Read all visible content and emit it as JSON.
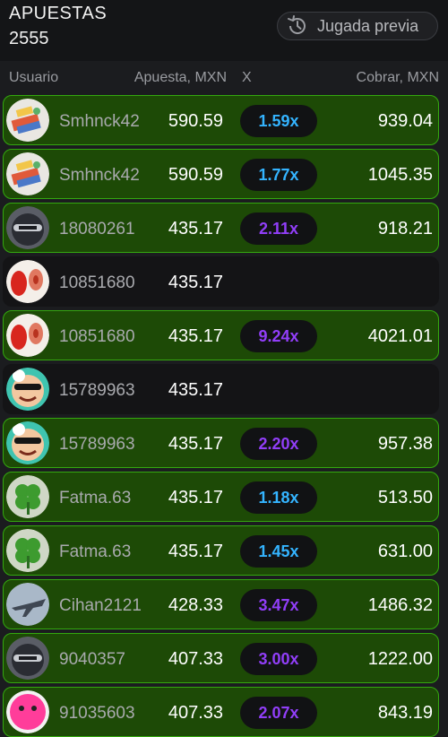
{
  "header": {
    "title": "APUESTAS",
    "count": "2555",
    "prev_button": "Jugada previa",
    "history_icon": "history-clock-icon"
  },
  "columns": {
    "user": "Usuario",
    "bet": "Apuesta, MXN",
    "mult": "X",
    "win": "Cobrar, MXN"
  },
  "colors": {
    "win_row_bg": "#1d4a06",
    "win_row_border": "#34a80f",
    "mult_blue": "#34b4ff",
    "mult_purple": "#913ef8"
  },
  "rows": [
    {
      "user": "Smhnck42",
      "bet": "590.59",
      "mult": "1.59x",
      "win": "939.04",
      "won": true,
      "mult_color": "#34b4ff",
      "avatar": "colorful-pattern-avatar"
    },
    {
      "user": "Smhnck42",
      "bet": "590.59",
      "mult": "1.77x",
      "win": "1045.35",
      "won": true,
      "mult_color": "#34b4ff",
      "avatar": "colorful-pattern-avatar"
    },
    {
      "user": "18080261",
      "bet": "435.17",
      "mult": "2.11x",
      "win": "918.21",
      "won": true,
      "mult_color": "#913ef8",
      "avatar": "ninja-avatar"
    },
    {
      "user": "10851680",
      "bet": "435.17",
      "mult": "",
      "win": "",
      "won": false,
      "mult_color": "#913ef8",
      "avatar": "red-eggs-avatar"
    },
    {
      "user": "10851680",
      "bet": "435.17",
      "mult": "9.24x",
      "win": "4021.01",
      "won": true,
      "mult_color": "#913ef8",
      "avatar": "red-eggs-avatar"
    },
    {
      "user": "15789963",
      "bet": "435.17",
      "mult": "",
      "win": "",
      "won": false,
      "mult_color": "#913ef8",
      "avatar": "sunglasses-face-avatar"
    },
    {
      "user": "15789963",
      "bet": "435.17",
      "mult": "2.20x",
      "win": "957.38",
      "won": true,
      "mult_color": "#913ef8",
      "avatar": "sunglasses-face-avatar"
    },
    {
      "user": "Fatma.63",
      "bet": "435.17",
      "mult": "1.18x",
      "win": "513.50",
      "won": true,
      "mult_color": "#34b4ff",
      "avatar": "clover-avatar"
    },
    {
      "user": "Fatma.63",
      "bet": "435.17",
      "mult": "1.45x",
      "win": "631.00",
      "won": true,
      "mult_color": "#34b4ff",
      "avatar": "clover-avatar"
    },
    {
      "user": "Cihan2121",
      "bet": "428.33",
      "mult": "3.47x",
      "win": "1486.32",
      "won": true,
      "mult_color": "#913ef8",
      "avatar": "jet-avatar"
    },
    {
      "user": "9040357",
      "bet": "407.33",
      "mult": "3.00x",
      "win": "1222.00",
      "won": true,
      "mult_color": "#913ef8",
      "avatar": "ninja-avatar"
    },
    {
      "user": "91035603",
      "bet": "407.33",
      "mult": "2.07x",
      "win": "843.19",
      "won": true,
      "mult_color": "#913ef8",
      "avatar": "pink-smiley-avatar"
    }
  ]
}
